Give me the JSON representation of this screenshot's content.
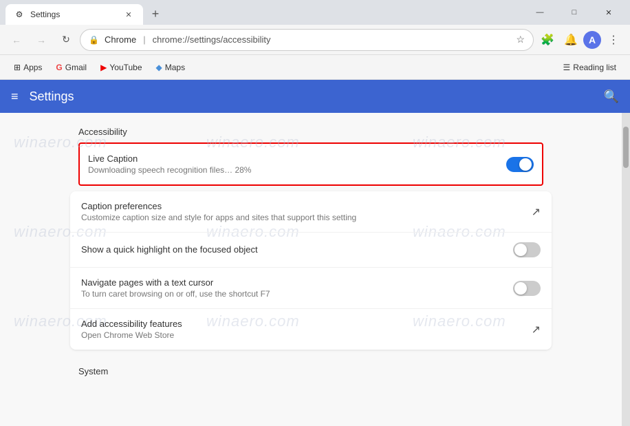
{
  "titlebar": {
    "tab": {
      "favicon": "⚙",
      "title": "Settings",
      "close": "✕"
    },
    "new_tab": "+",
    "controls": {
      "minimize": "—",
      "maximize": "□",
      "close": "✕"
    }
  },
  "toolbar": {
    "back": "←",
    "forward": "→",
    "refresh": "↻",
    "address": {
      "site": "Chrome",
      "separator": "|",
      "path": "chrome://settings/accessibility"
    },
    "bookmark": "☆",
    "extensions": "🧩",
    "notifications": "🔔",
    "avatar_letter": "A",
    "more": "⋮"
  },
  "bookmarks": {
    "items": [
      {
        "icon": "⊞",
        "label": "Apps"
      },
      {
        "icon": "G",
        "label": "Gmail"
      },
      {
        "icon": "▶",
        "label": "YouTube"
      },
      {
        "icon": "◆",
        "label": "Maps"
      }
    ],
    "reading_list_icon": "☰",
    "reading_list_label": "Reading list"
  },
  "settings_header": {
    "menu_icon": "≡",
    "title": "Settings",
    "search_icon": "🔍"
  },
  "content": {
    "accessibility_title": "Accessibility",
    "highlighted_row": {
      "title": "Live Caption",
      "description": "Downloading speech recognition files… 28%",
      "toggle_state": "on"
    },
    "rows": [
      {
        "title": "Caption preferences",
        "description": "Customize caption size and style for apps and sites that support this setting",
        "action": "external_link"
      },
      {
        "title": "Show a quick highlight on the focused object",
        "description": "",
        "action": "toggle_off"
      },
      {
        "title": "Navigate pages with a text cursor",
        "description": "To turn caret browsing on or off, use the shortcut F7",
        "action": "toggle_off"
      },
      {
        "title": "Add accessibility features",
        "description": "Open Chrome Web Store",
        "action": "external_link"
      }
    ],
    "system_title": "System"
  }
}
